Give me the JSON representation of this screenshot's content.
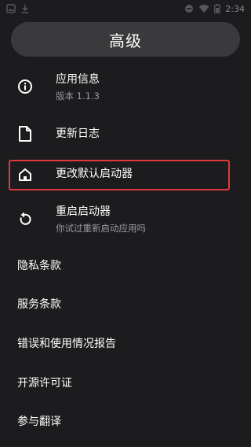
{
  "status_bar": {
    "time": "2:34",
    "icons": [
      "gallery-icon",
      "download-icon",
      "do-not-disturb-icon",
      "wifi-icon",
      "battery-icon"
    ]
  },
  "header": {
    "title": "高级"
  },
  "icon_items": [
    {
      "icon": "info-icon",
      "label": "应用信息",
      "sub": "版本 1.1.3"
    },
    {
      "icon": "file-icon",
      "label": "更新日志",
      "sub": ""
    },
    {
      "icon": "home-icon",
      "label": "更改默认启动器",
      "sub": ""
    },
    {
      "icon": "restart-icon",
      "label": "重启启动器",
      "sub": "你试过重新启动应用吗"
    }
  ],
  "plain_items": [
    {
      "label": "隐私条款"
    },
    {
      "label": "服务条款"
    },
    {
      "label": "错误和使用情况报告"
    },
    {
      "label": "开源许可证"
    },
    {
      "label": "参与翻译"
    }
  ],
  "colors": {
    "background": "#1c1c1e",
    "pill": "#3a3a3c",
    "highlight_border": "#e0393a",
    "subtext": "#9a9aa0"
  }
}
